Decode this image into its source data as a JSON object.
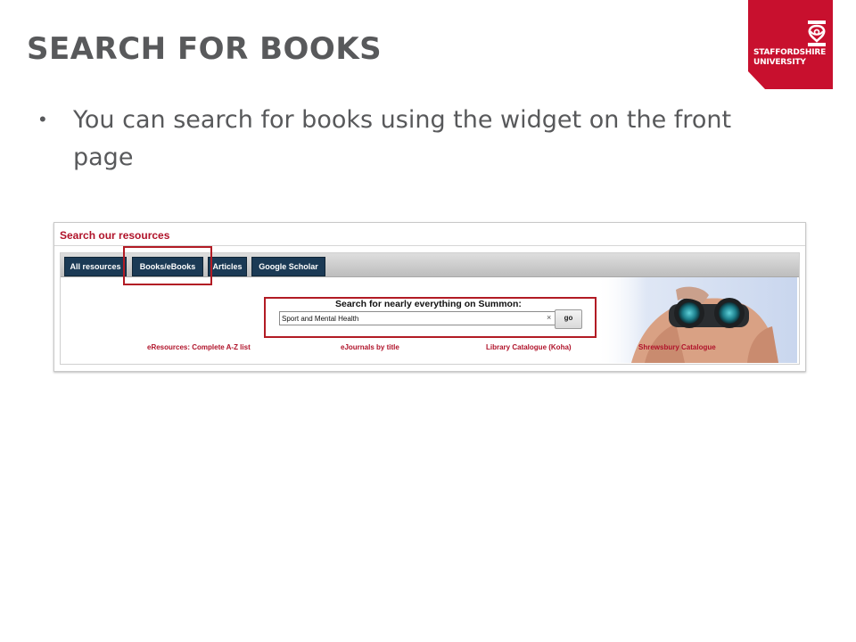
{
  "slide": {
    "title": "SEARCH FOR BOOKS",
    "bullet_text": "You can search for books using the widget on the front page"
  },
  "logo": {
    "line1": "STAFFORDSHIRE",
    "line2": "UNIVERSITY",
    "brand_color": "#c8102e"
  },
  "widget": {
    "title": "Search our resources",
    "tabs": [
      {
        "label": "All resources"
      },
      {
        "label": "Books/eBooks",
        "highlighted": true
      },
      {
        "label": "Articles"
      },
      {
        "label": "Google Scholar"
      }
    ],
    "search": {
      "heading": "Search for nearly everything on Summon:",
      "value": "Sport and Mental Health",
      "clear_symbol": "×",
      "go_label": "go"
    },
    "links": [
      {
        "label": "eResources: Complete A-Z list"
      },
      {
        "label": "eJournals by title"
      },
      {
        "label": "Library Catalogue (Koha)"
      },
      {
        "label": "Shrewsbury Catalogue"
      }
    ],
    "tab_color": "#1b3a55",
    "link_color": "#b0132a",
    "highlight_color": "#b21b24",
    "image": "binoculars-photo"
  }
}
